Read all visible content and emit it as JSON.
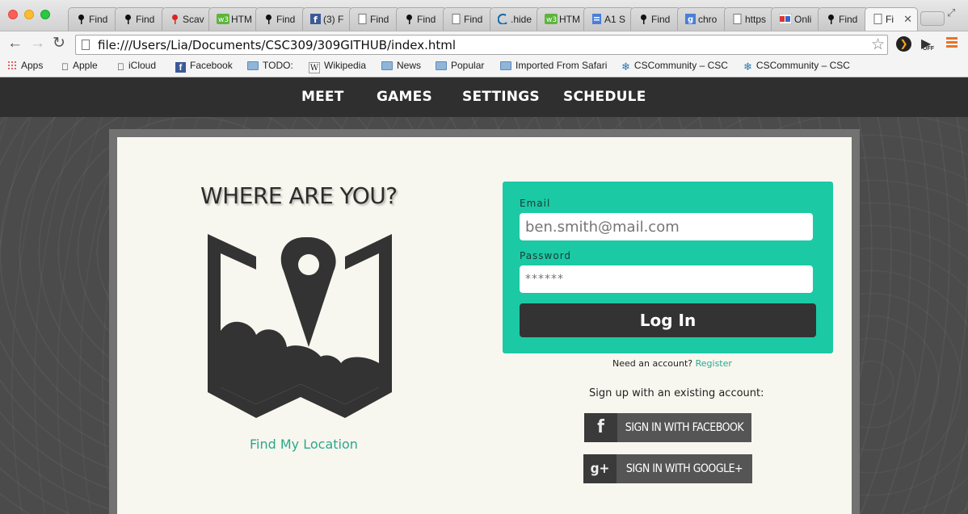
{
  "browser": {
    "tabs": [
      {
        "title": "Find",
        "icon": "map-pin-icon"
      },
      {
        "title": "Find",
        "icon": "map-pin-icon"
      },
      {
        "title": "Scav",
        "icon": "red-pin-icon"
      },
      {
        "title": "HTM",
        "icon": "w3-icon"
      },
      {
        "title": "Find",
        "icon": "map-pin-icon"
      },
      {
        "title": "(3) F",
        "icon": "facebook-icon"
      },
      {
        "title": "Find",
        "icon": "page-icon"
      },
      {
        "title": "Find",
        "icon": "map-pin-icon"
      },
      {
        "title": "Find",
        "icon": "page-icon"
      },
      {
        "title": ".hide",
        "icon": "jquery-icon"
      },
      {
        "title": "HTM",
        "icon": "w3-icon"
      },
      {
        "title": "A1 S",
        "icon": "doc-icon"
      },
      {
        "title": "Find",
        "icon": "map-pin-icon"
      },
      {
        "title": "chro",
        "icon": "google-icon"
      },
      {
        "title": "https",
        "icon": "page-icon"
      },
      {
        "title": "Onli",
        "icon": "online-icon"
      },
      {
        "title": "Find",
        "icon": "map-pin-icon"
      },
      {
        "title": "Fi",
        "icon": "page-icon",
        "active": true
      }
    ],
    "url": "file:///Users/Lia/Documents/CSC309/309GITHUB/index.html",
    "extension_off_label": "OFF",
    "bookmarks": [
      {
        "label": "Apps",
        "icon": "apps-grid-icon"
      },
      {
        "label": "Apple",
        "icon": "apple-icon"
      },
      {
        "label": "iCloud",
        "icon": "apple-icon"
      },
      {
        "label": "Facebook",
        "icon": "facebook-icon"
      },
      {
        "label": "TODO:",
        "icon": "folder-icon"
      },
      {
        "label": "Wikipedia",
        "icon": "wikipedia-icon"
      },
      {
        "label": "News",
        "icon": "folder-icon"
      },
      {
        "label": "Popular",
        "icon": "folder-icon"
      },
      {
        "label": "Imported From Safari",
        "icon": "folder-icon"
      },
      {
        "label": "CSCommunity – CSC",
        "icon": "snowflake-icon"
      },
      {
        "label": "CSCommunity – CSC",
        "icon": "snowflake-icon"
      }
    ]
  },
  "site": {
    "nav": [
      "MEET",
      "GAMES",
      "SETTINGS",
      "SCHEDULE"
    ],
    "headline": "WHERE ARE YOU?",
    "find_location": "Find My Location",
    "login": {
      "email_label": "Email",
      "email_placeholder": "ben.smith@mail.com",
      "password_label": "Password",
      "password_placeholder": "******",
      "button": "Log In"
    },
    "need_account": "Need an account?",
    "register": "Register",
    "signup_text": "Sign up with an existing account:",
    "facebook_button": "Sign in with Facebook",
    "google_button": "Sign in with Google+",
    "accent_color": "#1bc9a5"
  }
}
